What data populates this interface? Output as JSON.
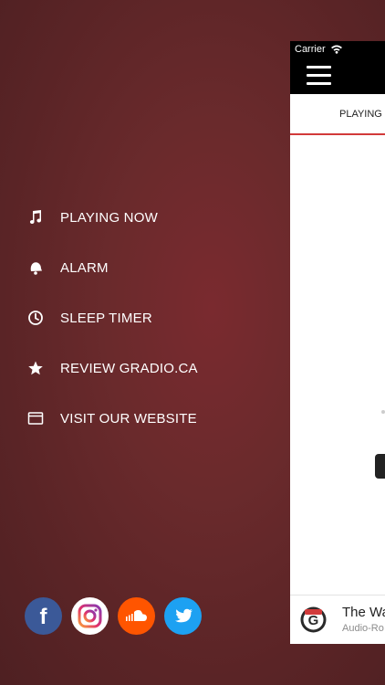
{
  "menu": {
    "items": [
      {
        "label": "PLAYING NOW",
        "icon": "music-note-icon"
      },
      {
        "label": "ALARM",
        "icon": "alarm-bell-icon"
      },
      {
        "label": "SLEEP TIMER",
        "icon": "clock-icon"
      },
      {
        "label": "REVIEW GRADIO.CA",
        "icon": "star-icon"
      },
      {
        "label": "VISIT OUR WEBSITE",
        "icon": "browser-window-icon"
      }
    ]
  },
  "socials": [
    {
      "name": "facebook",
      "icon": "facebook-icon",
      "color": "#3b5998"
    },
    {
      "name": "instagram",
      "icon": "instagram-icon",
      "color": "#c13584"
    },
    {
      "name": "soundcloud",
      "icon": "soundcloud-icon",
      "color": "#ff5500"
    },
    {
      "name": "twitter",
      "icon": "twitter-icon",
      "color": "#1da1f2"
    }
  ],
  "phone": {
    "status": {
      "carrier": "Carrier"
    },
    "tab": {
      "label": "PLAYING"
    },
    "player": {
      "title": "The Wa",
      "subtitle": "Audio-Ro"
    }
  },
  "colors": {
    "background": "#5e2426",
    "accent": "#d23a3a"
  }
}
